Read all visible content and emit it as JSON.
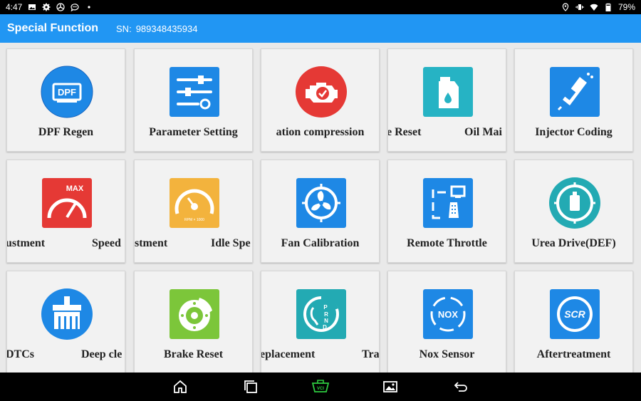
{
  "status_bar": {
    "time": "4:47",
    "battery": "79%",
    "left_icons": [
      "image-icon",
      "settings-icon",
      "wind-icon",
      "chat-icon",
      "dot-icon"
    ],
    "right_icons": [
      "location-icon",
      "vibrate-icon",
      "wifi-icon",
      "battery-icon"
    ]
  },
  "header": {
    "title": "Special Function",
    "sn_label": "SN:",
    "sn_value": "989348435934",
    "color": "#2196f3"
  },
  "tiles": [
    {
      "label": "DPF Regen",
      "icon": "dpf-icon"
    },
    {
      "label": "Parameter Setting",
      "icon": "sliders-icon"
    },
    {
      "label": "ation compression",
      "icon": "engine-check-icon"
    },
    {
      "label_parts": [
        "e Reset",
        "Oil Mai"
      ],
      "icon": "oil-can-icon"
    },
    {
      "label": "Injector Coding",
      "icon": "injector-icon"
    },
    {
      "label_parts": [
        "ustment",
        "Speed"
      ],
      "icon": "max-speed-gauge-icon"
    },
    {
      "label_parts": [
        "stment",
        "Idle Spe"
      ],
      "icon": "rpm-gauge-icon"
    },
    {
      "label": "Fan Calibration",
      "icon": "fan-icon"
    },
    {
      "label": "Remote Throttle",
      "icon": "remote-throttle-icon"
    },
    {
      "label": "Urea Drive(DEF)",
      "icon": "urea-tank-icon"
    },
    {
      "label_parts": [
        "DTCs",
        "Deep cle"
      ],
      "icon": "brush-icon"
    },
    {
      "label": "Brake Reset",
      "icon": "brake-disc-icon"
    },
    {
      "label_parts": [
        "eplacement",
        "Tra"
      ],
      "icon": "gear-shift-icon"
    },
    {
      "label": "Nox Sensor",
      "icon": "nox-icon"
    },
    {
      "label": "Aftertreatment",
      "icon": "scr-icon"
    }
  ],
  "nav_bar": {
    "icons": [
      "home-icon",
      "recents-icon",
      "vci-icon",
      "gallery-icon",
      "back-icon"
    ],
    "vci_label": "VCI",
    "vci_color": "#2ecc40"
  }
}
